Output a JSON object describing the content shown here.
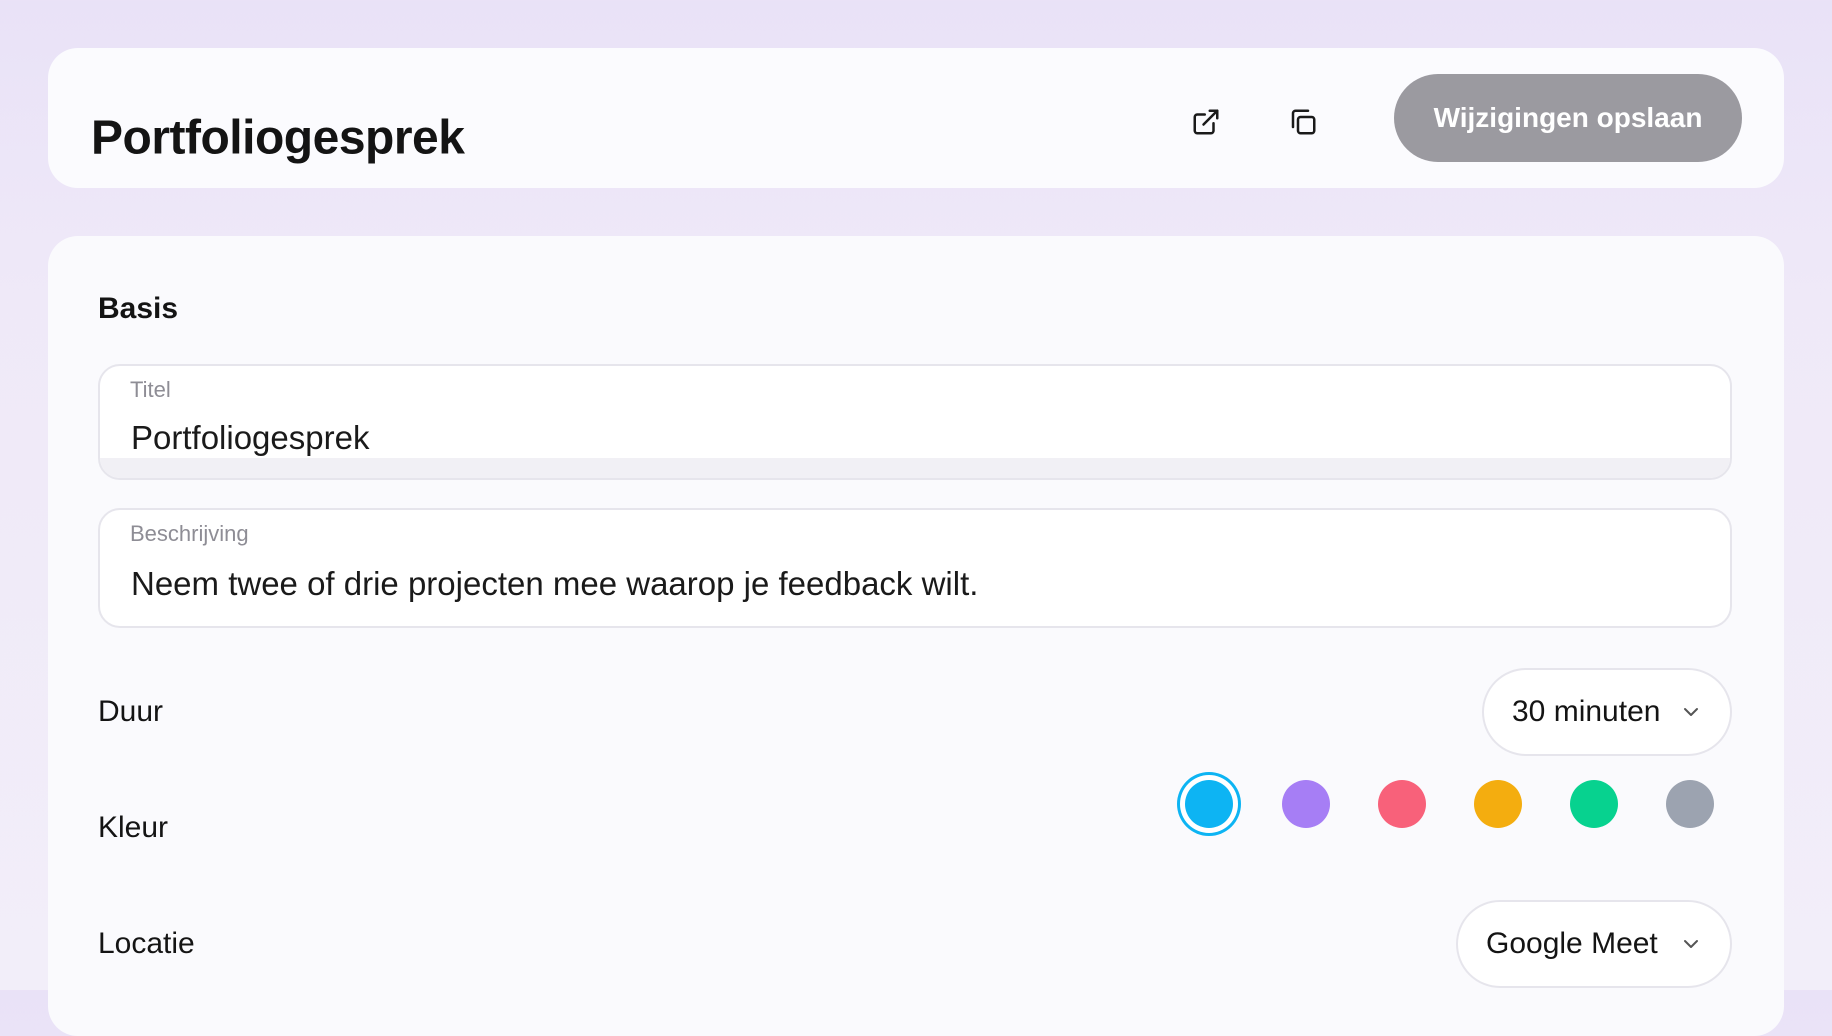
{
  "header": {
    "title": "Portfoliogesprek",
    "save_label": "Wijzigingen opslaan",
    "icons": [
      "external-link-icon",
      "copy-icon"
    ]
  },
  "basis": {
    "section_title": "Basis",
    "title_field": {
      "label": "Titel",
      "value": "Portfoliogesprek"
    },
    "description_field": {
      "label": "Beschrijving",
      "value": "Neem twee of drie projecten mee waarop je feedback wilt."
    },
    "duration": {
      "label": "Duur",
      "value": "30 minuten"
    },
    "color": {
      "label": "Kleur",
      "options": [
        "#0db4f3",
        "#a67ef5",
        "#f8617a",
        "#f4ad0f",
        "#07d28f",
        "#9ca3b0"
      ],
      "selected": "#0db4f3"
    },
    "location": {
      "label": "Locatie",
      "value": "Google Meet"
    }
  }
}
